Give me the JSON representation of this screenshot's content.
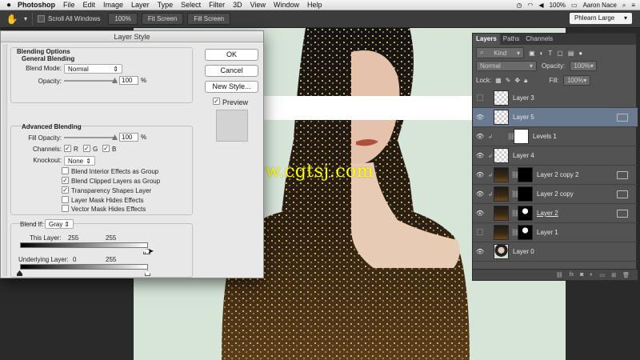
{
  "menubar": {
    "apple": "",
    "app": "Photoshop",
    "items": [
      "File",
      "Edit",
      "Image",
      "Layer",
      "Type",
      "Select",
      "Filter",
      "3D",
      "View",
      "Window",
      "Help"
    ],
    "battery": "100%",
    "user": "Aaron Nace"
  },
  "options": {
    "scroll_all": "Scroll All Windows",
    "zoom100": "100%",
    "fit_screen": "Fit Screen",
    "fill_screen": "Fill Screen",
    "workspace": "Phlearn Large"
  },
  "watermark": "www.cgtsj.com",
  "dialog": {
    "title": "Layer Style",
    "blending_options": "Blending Options",
    "general_blending": "General Blending",
    "blend_mode_label": "Blend Mode:",
    "blend_mode_value": "Normal",
    "opacity_label": "Opacity:",
    "opacity_value": "100",
    "advanced_blending": "Advanced Blending",
    "fill_opacity_label": "Fill Opacity:",
    "fill_opacity_value": "100",
    "percent": "%",
    "channels_label": "Channels:",
    "ch_r": "R",
    "ch_g": "G",
    "ch_b": "B",
    "knockout_label": "Knockout:",
    "knockout_value": "None",
    "opt1": "Blend Interior Effects as Group",
    "opt2": "Blend Clipped Layers as Group",
    "opt3": "Transparency Shapes Layer",
    "opt4": "Layer Mask Hides Effects",
    "opt5": "Vector Mask Hides Effects",
    "blend_if_label": "Blend If:",
    "blend_if_value": "Gray",
    "this_layer_label": "This Layer:",
    "this_layer_low": "255",
    "this_layer_high": "255",
    "underlying_label": "Underlying Layer:",
    "underlying_low": "0",
    "underlying_high": "255",
    "ok": "OK",
    "cancel": "Cancel",
    "new_style": "New Style...",
    "preview": "Preview",
    "checked": "✓"
  },
  "layers": {
    "tabs": [
      "Layers",
      "Paths",
      "Channels"
    ],
    "kind": "Kind",
    "mode": "Normal",
    "opacity_label": "Opacity:",
    "opacity_value": "100%",
    "lock_label": "Lock:",
    "fill_label": "Fill:",
    "fill_value": "100%",
    "items": [
      {
        "name": "Layer 3"
      },
      {
        "name": "Layer 5"
      },
      {
        "name": "Levels 1"
      },
      {
        "name": "Layer 4"
      },
      {
        "name": "Layer 2 copy 2"
      },
      {
        "name": "Layer 2 copy"
      },
      {
        "name": "Layer 2"
      },
      {
        "name": "Layer 1"
      },
      {
        "name": "Layer 0"
      }
    ],
    "footer_icons": [
      "link-icon",
      "fx-icon",
      "mask-icon",
      "adjustment-icon",
      "group-icon",
      "new-layer-icon",
      "trash-icon"
    ]
  }
}
